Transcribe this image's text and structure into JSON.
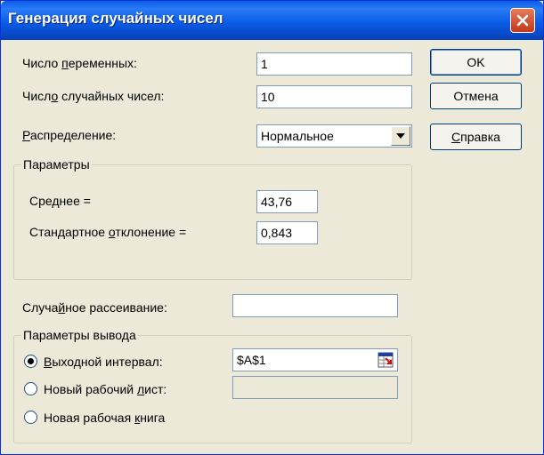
{
  "window": {
    "title": "Генерация случайных чисел"
  },
  "labels": {
    "num_vars_prefix": "Число ",
    "num_vars_u": "п",
    "num_vars_suffix": "еременных:",
    "num_rand_prefix": "Числ",
    "num_rand_u": "о",
    "num_rand_suffix": " случайных чисел:",
    "dist_u": "Р",
    "dist_suffix": "аспределение:",
    "params_group": "Параметры",
    "mean_prefix": "Сре",
    "mean_u": "д",
    "mean_suffix": "нее =",
    "std_prefix": "Стандартное ",
    "std_u": "о",
    "std_suffix": "тклонение =",
    "seed_prefix": "Случа",
    "seed_u": "й",
    "seed_suffix": "ное рассеивание:",
    "output_group": "Параметры вывода",
    "out_range_u": "В",
    "out_range_suffix": "ыходной интервал:",
    "new_sheet_prefix": "Новый рабочий ",
    "new_sheet_u": "л",
    "new_sheet_suffix": "ист:",
    "new_book_prefix": "Новая рабочая ",
    "new_book_u": "к",
    "new_book_suffix": "нига"
  },
  "fields": {
    "num_vars": "1",
    "num_rand": "10",
    "distribution": "Нормальное",
    "mean": "43,76",
    "std": "0,843",
    "seed": "",
    "output_range": "$A$1",
    "new_sheet": ""
  },
  "buttons": {
    "ok": "OK",
    "cancel": "Отмена",
    "help_u": "С",
    "help_suffix": "правка"
  },
  "colors": {
    "titlebar": "#0a5ce8",
    "dialog_bg": "#ece9d8",
    "close": "#c4371a"
  }
}
